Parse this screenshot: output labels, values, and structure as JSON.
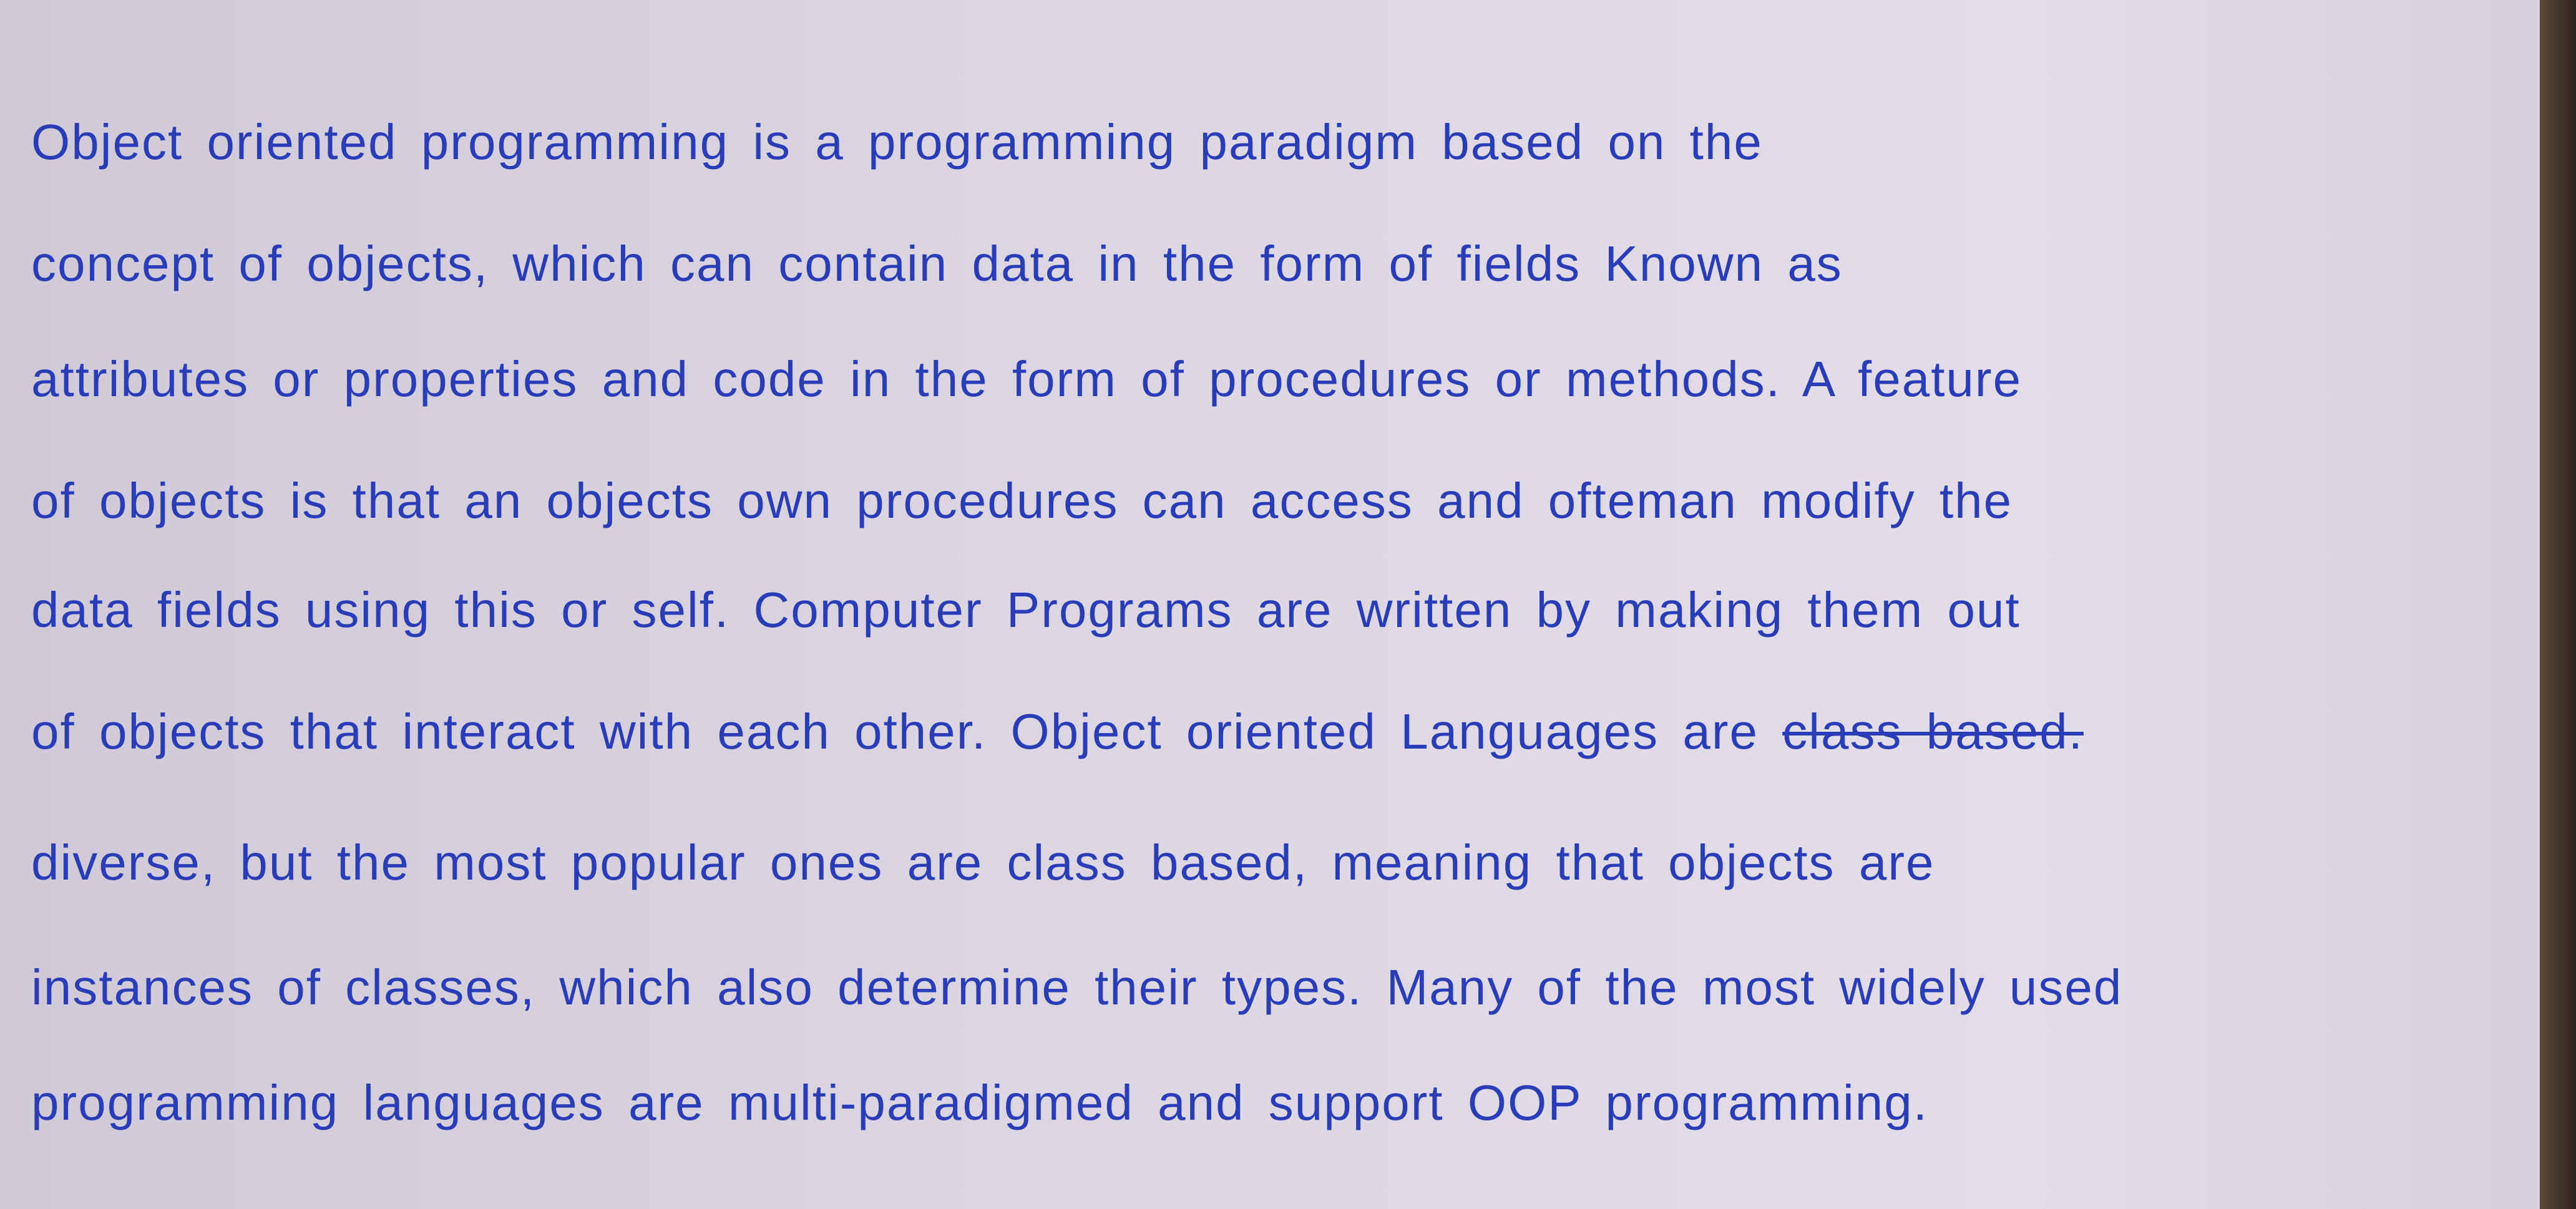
{
  "document": {
    "lines": [
      "Object oriented programming is a programming paradigm based on the",
      "concept of objects, which can contain data in the form of fields Known as",
      "attributes or properties and code in the form of procedures or methods. A feature",
      "of objects is that an objects own procedures can access and ofteman modify the",
      "data fields using this or self. Computer Programs are written by making them out",
      "of objects that interact with each other. Object oriented Languages are",
      "diverse, but the most popular ones are class based, meaning that objects are",
      "instances of classes, which also determine their types. Many of the most widely used",
      "programming languages are multi-paradigmed and support OOP programming."
    ],
    "struck_text": "class based."
  },
  "colors": {
    "ink": "#2a3db8",
    "paper": "#d8d2e0"
  }
}
